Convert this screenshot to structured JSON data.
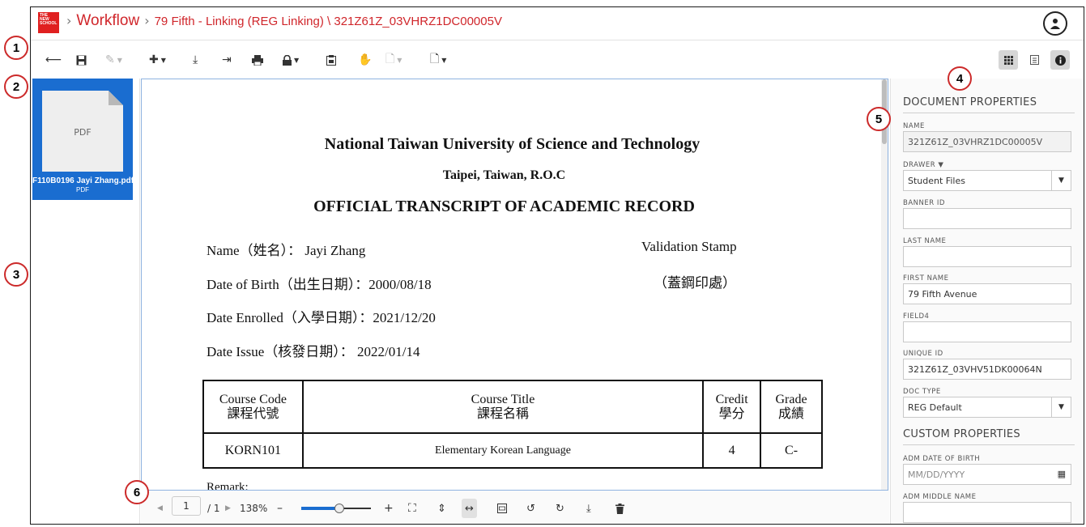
{
  "callouts": [
    "1",
    "2",
    "3",
    "4",
    "5",
    "6"
  ],
  "header": {
    "logo_text": "THE NEW SCHOOL",
    "home": "Workflow",
    "path": "79 Fifth - Linking (REG Linking) \\ 321Z61Z_03VHRZ1DC00005V"
  },
  "thumbnail": {
    "page_label": "PDF",
    "file_name": "F110B0196 Jayi Zhang.pdf",
    "file_type": "PDF"
  },
  "document": {
    "university": "National Taiwan University of Science and Technology",
    "location": "Taipei, Taiwan, R.O.C",
    "heading": "OFFICIAL TRANSCRIPT OF ACADEMIC RECORD",
    "name_line": "Name（姓名）： Jayi Zhang",
    "dob_line": "Date of Birth（出生日期）：2000/08/18",
    "enrolled_line": "Date Enrolled（入學日期）：2021/12/20",
    "issue_line": "Date Issue（核發日期）： 2022/01/14",
    "stamp_en": "Validation Stamp",
    "stamp_zh": "（蓋鋼印處）",
    "table": {
      "headers": [
        {
          "en": "Course Code",
          "zh": "課程代號"
        },
        {
          "en": "Course Title",
          "zh": "課程名稱"
        },
        {
          "en": "Credit",
          "zh": "學分"
        },
        {
          "en": "Grade",
          "zh": "成績"
        }
      ],
      "rows": [
        [
          "KORN101",
          "Elementary Korean Language",
          "4",
          "C-"
        ]
      ]
    },
    "remark": "Remark:"
  },
  "viewer": {
    "page_current": "1",
    "page_total": "/ 1",
    "zoom": "138%",
    "zoom_slider_fraction": 0.55,
    "minus": "–",
    "plus": "+"
  },
  "properties": {
    "document_section": "DOCUMENT PROPERTIES",
    "name_label": "NAME",
    "name_value": "321Z61Z_03VHRZ1DC00005V",
    "drawer_label": "DRAWER",
    "drawer_value": "Student Files",
    "banner_label": "BANNER ID",
    "banner_value": "",
    "last_name_label": "LAST NAME",
    "last_name_value": "",
    "first_name_label": "FIRST NAME",
    "first_name_value": "79 Fifth Avenue",
    "field4_label": "FIELD4",
    "field4_value": "",
    "unique_label": "UNIQUE ID",
    "unique_value": "321Z61Z_03VHV51DK00064N",
    "doctype_label": "DOC TYPE",
    "doctype_value": "REG Default",
    "custom_section": "CUSTOM PROPERTIES",
    "adm_dob_label": "ADM DATE OF BIRTH",
    "adm_dob_placeholder": "MM/DD/YYYY",
    "adm_middle_label": "ADM MIDDLE NAME"
  },
  "colors": {
    "brand_red": "#d0262b",
    "selection_blue": "#1a6dd0",
    "callout_ring": "#cc2a2a"
  }
}
